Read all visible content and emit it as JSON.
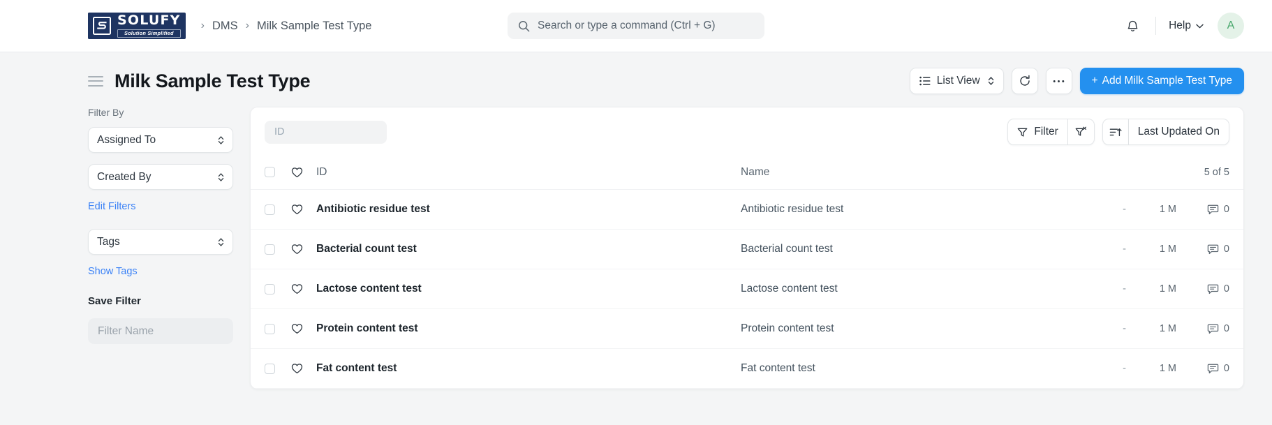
{
  "navbar": {
    "logo": {
      "name": "SOLUFY",
      "tagline": "Solution Simplified",
      "mark": "s-monogram-icon"
    },
    "breadcrumb": [
      {
        "label": "DMS"
      },
      {
        "label": "Milk Sample Test Type"
      }
    ],
    "search": {
      "placeholder": "Search or type a command (Ctrl + G)",
      "value": "",
      "icon": "search-icon"
    },
    "notifications_icon": "bell-icon",
    "help": {
      "label": "Help",
      "icon": "chevron-down-icon"
    },
    "avatar": {
      "initial": "A",
      "bg": "#e4f2e8",
      "fg": "#48a76c"
    }
  },
  "page": {
    "menu_icon": "hamburger-menu-icon",
    "title": "Milk Sample Test Type",
    "actions": {
      "view_switch": {
        "label": "List View",
        "icon": "list-icon",
        "stepper": "up-down-chevron-icon"
      },
      "refresh": {
        "icon": "refresh-icon"
      },
      "more": {
        "icon": "ellipsis-icon"
      },
      "add": {
        "label": "Add Milk Sample Test Type",
        "prefix": "+",
        "color": "#2490ef"
      }
    }
  },
  "sidebar": {
    "filter_by_label": "Filter By",
    "selects": [
      {
        "label": "Assigned To"
      },
      {
        "label": "Created By"
      }
    ],
    "edit_filters_link": "Edit Filters",
    "tags_select": {
      "label": "Tags"
    },
    "show_tags_link": "Show Tags",
    "save_filter_heading": "Save Filter",
    "filter_name_placeholder": "Filter Name",
    "filter_name_value": ""
  },
  "list": {
    "id_filter": {
      "placeholder": "ID",
      "value": ""
    },
    "toolbar": {
      "filter_label": "Filter",
      "filter_icon": "funnel-icon",
      "clear_filter_icon": "funnel-x-icon",
      "sort_icon": "sort-ascending-icon",
      "sort_field": "Last Updated On"
    },
    "columns": {
      "select_all": "select-all-checkbox",
      "like_icon": "heart-icon",
      "id": "ID",
      "name": "Name",
      "count": "5 of 5"
    },
    "rows": [
      {
        "id": "Antibiotic residue test",
        "name": "Antibiotic residue test",
        "assigned": "-",
        "modified": "1 M",
        "comments": "0"
      },
      {
        "id": "Bacterial count test",
        "name": "Bacterial count test",
        "assigned": "-",
        "modified": "1 M",
        "comments": "0"
      },
      {
        "id": "Lactose content test",
        "name": "Lactose content test",
        "assigned": "-",
        "modified": "1 M",
        "comments": "0"
      },
      {
        "id": "Protein content test",
        "name": "Protein content test",
        "assigned": "-",
        "modified": "1 M",
        "comments": "0"
      },
      {
        "id": "Fat content test",
        "name": "Fat content test",
        "assigned": "-",
        "modified": "1 M",
        "comments": "0"
      }
    ]
  }
}
